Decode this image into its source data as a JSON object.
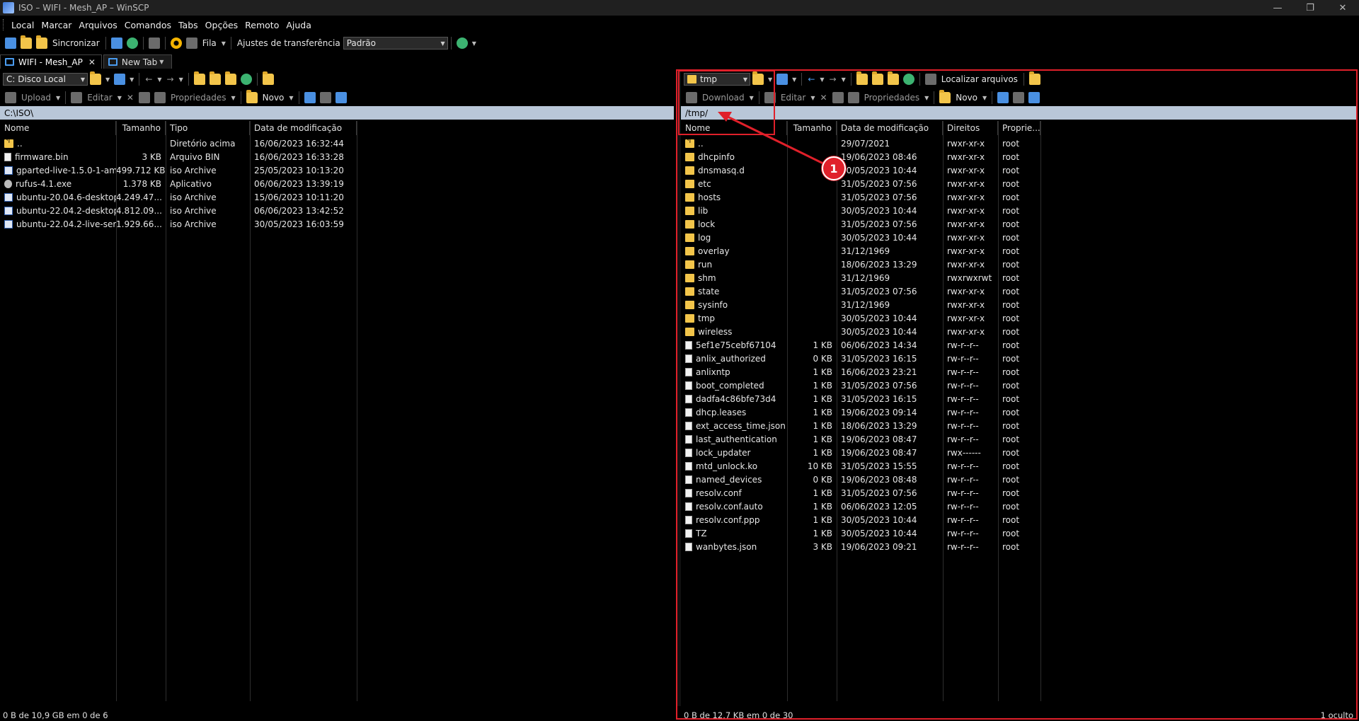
{
  "window": {
    "title": "ISO – WIFI - Mesh_AP – WinSCP",
    "minimize": "—",
    "maximize": "❐",
    "close": "✕"
  },
  "menu": [
    "Local",
    "Marcar",
    "Arquivos",
    "Comandos",
    "Tabs",
    "Opções",
    "Remoto",
    "Ajuda"
  ],
  "toolbar": {
    "sync_label": "Sincronizar",
    "queue_label": "Fila",
    "transfer_settings_label": "Ajustes de transferência",
    "transfer_preset": "Padrão"
  },
  "tabs": [
    {
      "label": "WIFI - Mesh_AP",
      "close": "✕"
    },
    {
      "label": "New Tab"
    }
  ],
  "left_panel": {
    "drive": "C: Disco Local",
    "upload_label": "Upload",
    "edit_label": "Editar",
    "properties_label": "Propriedades",
    "new_label": "Novo",
    "path": "C:\\ISO\\",
    "columns": [
      "Nome",
      "Tamanho",
      "Tipo",
      "Data de modificação"
    ],
    "rows": [
      {
        "icon": "up",
        "name": "..",
        "size": "",
        "type": "Diretório acima",
        "date": "16/06/2023 16:32:44"
      },
      {
        "icon": "file",
        "name": "firmware.bin",
        "size": "3 KB",
        "type": "Arquivo BIN",
        "date": "16/06/2023 16:33:28"
      },
      {
        "icon": "iso",
        "name": "gparted-live-1.5.0-1-am...",
        "size": "499.712 KB",
        "type": "iso Archive",
        "date": "25/05/2023 10:13:20"
      },
      {
        "icon": "exe",
        "name": "rufus-4.1.exe",
        "size": "1.378 KB",
        "type": "Aplicativo",
        "date": "06/06/2023 13:39:19"
      },
      {
        "icon": "iso",
        "name": "ubuntu-20.04.6-desktop...",
        "size": "4.249.47...",
        "type": "iso Archive",
        "date": "15/06/2023 10:11:20"
      },
      {
        "icon": "iso",
        "name": "ubuntu-22.04.2-desktop...",
        "size": "4.812.09...",
        "type": "iso Archive",
        "date": "06/06/2023 13:42:52"
      },
      {
        "icon": "iso",
        "name": "ubuntu-22.04.2-live-ser...",
        "size": "1.929.66...",
        "type": "iso Archive",
        "date": "30/05/2023 16:03:59"
      }
    ],
    "status": "0 B de 10,9 GB em 0 de 6"
  },
  "right_panel": {
    "dir": "tmp",
    "find_files_label": "Localizar arquivos",
    "download_label": "Download",
    "edit_label": "Editar",
    "properties_label": "Propriedades",
    "new_label": "Novo",
    "path": "/tmp/",
    "columns": [
      "Nome",
      "Tamanho",
      "Data de modificação",
      "Direitos",
      "Proprie..."
    ],
    "rows": [
      {
        "icon": "up",
        "name": "..",
        "size": "",
        "date": "29/07/2021",
        "rights": "rwxr-xr-x",
        "owner": "root"
      },
      {
        "icon": "folder",
        "name": "dhcpinfo",
        "size": "",
        "date": "19/06/2023 08:46",
        "rights": "rwxr-xr-x",
        "owner": "root"
      },
      {
        "icon": "folder",
        "name": "dnsmasq.d",
        "size": "",
        "date": "30/05/2023 10:44",
        "rights": "rwxr-xr-x",
        "owner": "root"
      },
      {
        "icon": "folder",
        "name": "etc",
        "size": "",
        "date": "31/05/2023 07:56",
        "rights": "rwxr-xr-x",
        "owner": "root"
      },
      {
        "icon": "folder",
        "name": "hosts",
        "size": "",
        "date": "31/05/2023 07:56",
        "rights": "rwxr-xr-x",
        "owner": "root"
      },
      {
        "icon": "folder",
        "name": "lib",
        "size": "",
        "date": "30/05/2023 10:44",
        "rights": "rwxr-xr-x",
        "owner": "root"
      },
      {
        "icon": "folder",
        "name": "lock",
        "size": "",
        "date": "31/05/2023 07:56",
        "rights": "rwxr-xr-x",
        "owner": "root"
      },
      {
        "icon": "folder",
        "name": "log",
        "size": "",
        "date": "30/05/2023 10:44",
        "rights": "rwxr-xr-x",
        "owner": "root"
      },
      {
        "icon": "folder",
        "name": "overlay",
        "size": "",
        "date": "31/12/1969",
        "rights": "rwxr-xr-x",
        "owner": "root"
      },
      {
        "icon": "folder",
        "name": "run",
        "size": "",
        "date": "18/06/2023 13:29",
        "rights": "rwxr-xr-x",
        "owner": "root"
      },
      {
        "icon": "folder",
        "name": "shm",
        "size": "",
        "date": "31/12/1969",
        "rights": "rwxrwxrwt",
        "owner": "root"
      },
      {
        "icon": "folder",
        "name": "state",
        "size": "",
        "date": "31/05/2023 07:56",
        "rights": "rwxr-xr-x",
        "owner": "root"
      },
      {
        "icon": "folder",
        "name": "sysinfo",
        "size": "",
        "date": "31/12/1969",
        "rights": "rwxr-xr-x",
        "owner": "root"
      },
      {
        "icon": "folder",
        "name": "tmp",
        "size": "",
        "date": "30/05/2023 10:44",
        "rights": "rwxr-xr-x",
        "owner": "root"
      },
      {
        "icon": "folder",
        "name": "wireless",
        "size": "",
        "date": "30/05/2023 10:44",
        "rights": "rwxr-xr-x",
        "owner": "root"
      },
      {
        "icon": "file",
        "name": "5ef1e75cebf67104",
        "size": "1 KB",
        "date": "06/06/2023 14:34",
        "rights": "rw-r--r--",
        "owner": "root"
      },
      {
        "icon": "file",
        "name": "anlix_authorized",
        "size": "0 KB",
        "date": "31/05/2023 16:15",
        "rights": "rw-r--r--",
        "owner": "root"
      },
      {
        "icon": "file",
        "name": "anlixntp",
        "size": "1 KB",
        "date": "16/06/2023 23:21",
        "rights": "rw-r--r--",
        "owner": "root"
      },
      {
        "icon": "file",
        "name": "boot_completed",
        "size": "1 KB",
        "date": "31/05/2023 07:56",
        "rights": "rw-r--r--",
        "owner": "root"
      },
      {
        "icon": "file",
        "name": "dadfa4c86bfe73d4",
        "size": "1 KB",
        "date": "31/05/2023 16:15",
        "rights": "rw-r--r--",
        "owner": "root"
      },
      {
        "icon": "file",
        "name": "dhcp.leases",
        "size": "1 KB",
        "date": "19/06/2023 09:14",
        "rights": "rw-r--r--",
        "owner": "root"
      },
      {
        "icon": "file",
        "name": "ext_access_time.json",
        "size": "1 KB",
        "date": "18/06/2023 13:29",
        "rights": "rw-r--r--",
        "owner": "root"
      },
      {
        "icon": "file",
        "name": "last_authentication",
        "size": "1 KB",
        "date": "19/06/2023 08:47",
        "rights": "rw-r--r--",
        "owner": "root"
      },
      {
        "icon": "file",
        "name": "lock_updater",
        "size": "1 KB",
        "date": "19/06/2023 08:47",
        "rights": "rwx------",
        "owner": "root"
      },
      {
        "icon": "file",
        "name": "mtd_unlock.ko",
        "size": "10 KB",
        "date": "31/05/2023 15:55",
        "rights": "rw-r--r--",
        "owner": "root"
      },
      {
        "icon": "file",
        "name": "named_devices",
        "size": "0 KB",
        "date": "19/06/2023 08:48",
        "rights": "rw-r--r--",
        "owner": "root"
      },
      {
        "icon": "file",
        "name": "resolv.conf",
        "size": "1 KB",
        "date": "31/05/2023 07:56",
        "rights": "rw-r--r--",
        "owner": "root"
      },
      {
        "icon": "file",
        "name": "resolv.conf.auto",
        "size": "1 KB",
        "date": "06/06/2023 12:05",
        "rights": "rw-r--r--",
        "owner": "root"
      },
      {
        "icon": "file",
        "name": "resolv.conf.ppp",
        "size": "1 KB",
        "date": "30/05/2023 10:44",
        "rights": "rw-r--r--",
        "owner": "root"
      },
      {
        "icon": "file",
        "name": "TZ",
        "size": "1 KB",
        "date": "30/05/2023 10:44",
        "rights": "rw-r--r--",
        "owner": "root"
      },
      {
        "icon": "file",
        "name": "wanbytes.json",
        "size": "3 KB",
        "date": "19/06/2023 09:21",
        "rights": "rw-r--r--",
        "owner": "root"
      }
    ],
    "status": "0 B de 12,7 KB em 0 de 30",
    "hidden": "1 oculto"
  },
  "annotation": {
    "marker_label": "1",
    "color": "#e0202a"
  },
  "icons": [
    "folder-icon",
    "gear-icon",
    "sync-icon",
    "filter-icon",
    "back-icon",
    "forward-icon",
    "home-icon",
    "refresh-icon"
  ]
}
